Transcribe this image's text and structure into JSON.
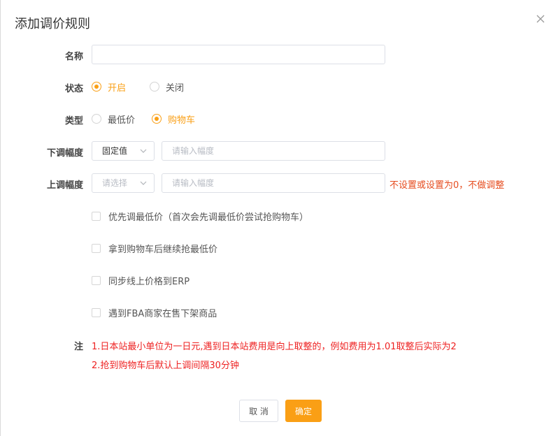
{
  "dialog": {
    "title": "添加调价规则",
    "close_icon": "close-icon"
  },
  "form": {
    "name": {
      "label": "名称",
      "value": "",
      "placeholder": ""
    },
    "status": {
      "label": "状态",
      "options": [
        {
          "label": "开启",
          "checked": true
        },
        {
          "label": "关闭",
          "checked": false
        }
      ]
    },
    "type": {
      "label": "类型",
      "options": [
        {
          "label": "最低价",
          "checked": false
        },
        {
          "label": "购物车",
          "checked": true
        }
      ]
    },
    "down": {
      "label": "下调幅度",
      "select_value": "固定值",
      "input_placeholder": "请输入幅度"
    },
    "up": {
      "label": "上调幅度",
      "select_placeholder": "请选择",
      "input_placeholder": "请输入幅度",
      "hint": "不设置或设置为0，不做调整"
    },
    "checkboxes": [
      {
        "label": "优先调最低价（首次会先调最低价尝试抢购物车）",
        "checked": false
      },
      {
        "label": "拿到购物车后继续抢最低价",
        "checked": false
      },
      {
        "label": "同步线上价格到ERP",
        "checked": false
      },
      {
        "label": "遇到FBA商家在售下架商品",
        "checked": false
      }
    ],
    "note": {
      "label": "注",
      "lines": [
        "1.日本站最小单位为一日元,遇到日本站费用是向上取整的，例如费用为1.01取整后实际为2",
        "2.抢到购物车后默认上调间隔30分钟"
      ]
    }
  },
  "footer": {
    "cancel_label": "取 消",
    "ok_label": "确定"
  },
  "colors": {
    "accent": "#fa9f15",
    "hint": "#e64c1f",
    "note": "#ee2222"
  }
}
